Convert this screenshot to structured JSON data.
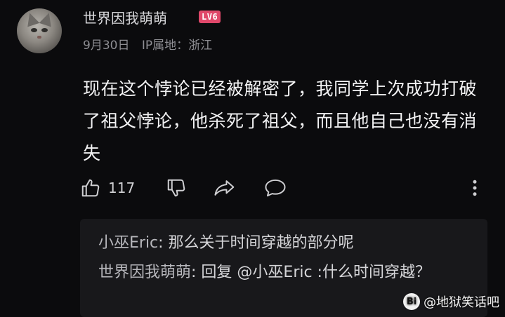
{
  "comment": {
    "username": "世界因我萌萌",
    "level_badge": "LV6",
    "date": "9月30日",
    "ip_location": "IP属地：浙江",
    "text": "现在这个悖论已经被解密了，我同学上次成功打破了祖父悖论，他杀死了祖父，而且他自己也没有消失",
    "like_count": "117",
    "icons": [
      "thumbs-up-icon",
      "thumbs-down-icon",
      "share-icon",
      "comment-icon",
      "more-icon"
    ]
  },
  "replies": [
    {
      "author": "小巫Eric",
      "text": ": 那么关于时间穿越的部分呢"
    },
    {
      "author": "世界因我萌萌",
      "text": ": 回复 @小巫Eric :什么时间穿越？"
    }
  ],
  "watermark": {
    "logo": "Bi",
    "text": "@地狱笑话吧"
  },
  "colors": {
    "background": "#0b0b0d",
    "badge": "#e0486a",
    "reply_bg": "#18181b"
  }
}
